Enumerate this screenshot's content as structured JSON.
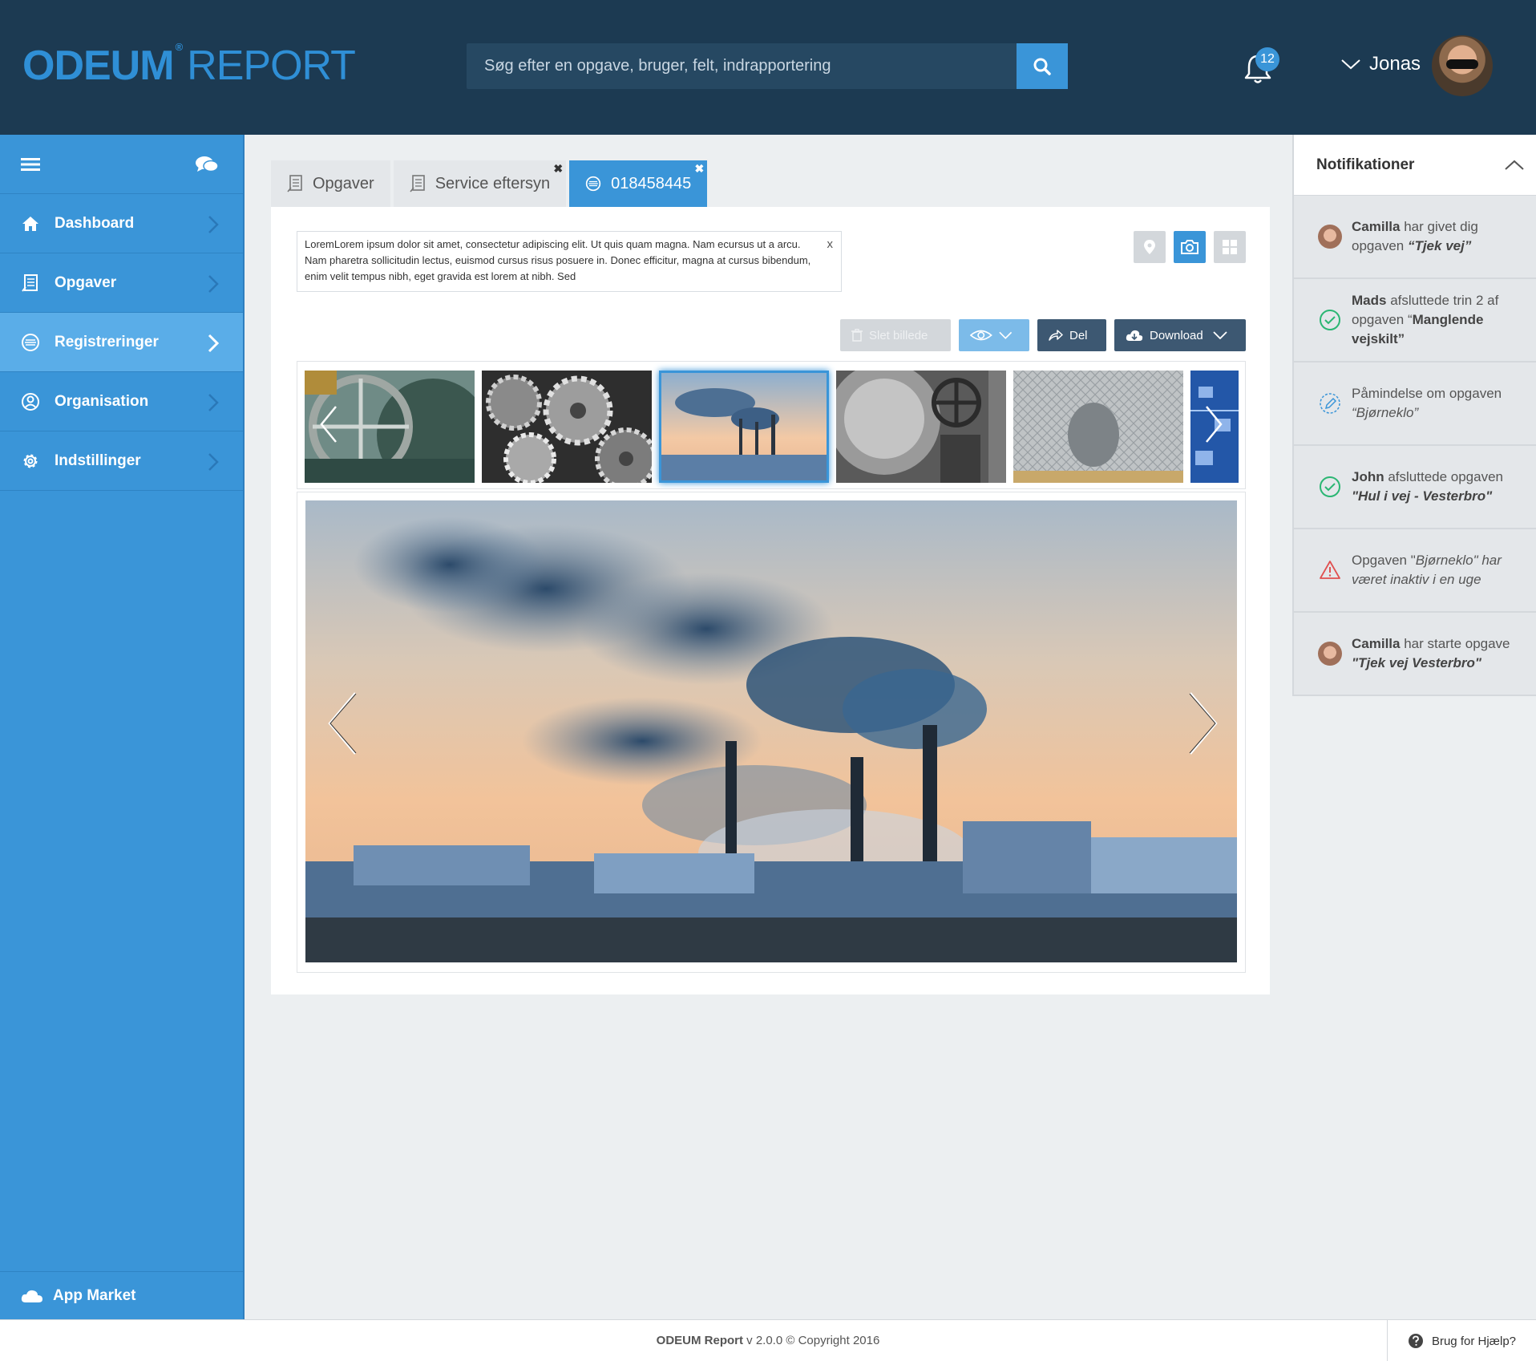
{
  "header": {
    "logo_part1": "ODEUM",
    "logo_reg": "®",
    "logo_part2": "REPORT",
    "search_placeholder": "Søg efter en opgave, bruger, felt, indrapportering",
    "notification_count": "12",
    "user_name": "Jonas"
  },
  "sidebar": {
    "items": [
      {
        "label": "Dashboard",
        "icon": "home-icon"
      },
      {
        "label": "Opgaver",
        "icon": "tasks-icon"
      },
      {
        "label": "Registreringer",
        "icon": "registrations-icon",
        "active": true
      },
      {
        "label": "Organisation",
        "icon": "user-icon"
      },
      {
        "label": "Indstillinger",
        "icon": "gear-icon"
      }
    ],
    "app_market": "App Market"
  },
  "tabs": [
    {
      "label": "Opgaver",
      "closable": false
    },
    {
      "label": "Service eftersyn",
      "closable": true
    },
    {
      "label": "018458445",
      "closable": true,
      "active": true
    }
  ],
  "info_text": "LoremLorem ipsum dolor sit amet, consectetur adipiscing elit. Ut quis quam magna. Nam ecursus ut a arcu. Nam pharetra sollicitudin lectus, euismod cursus risus posuere in. Donec efficitur, magna at cursus bibendum, enim velit tempus nibh, eget gravida est lorem at nibh. Sed",
  "info_close": "x",
  "actions": {
    "delete": "Slet billede",
    "share": "Del",
    "download": "Download"
  },
  "notifications": {
    "title": "Notifikationer",
    "items": [
      {
        "bold": "Camilla",
        "pre": "",
        "text": " har givet dig opgaven ",
        "em": "“Tjek vej”",
        "icon": "avatar"
      },
      {
        "bold": "Mads",
        "pre": "",
        "text": " afsluttede trin 2 af opgaven “",
        "em": "Manglende vejskilt”",
        "icon": "check-icon"
      },
      {
        "bold": "",
        "pre": "Påmindelse om opgaven ",
        "text": "",
        "em": "“Bjørneklo”",
        "icon": "pencil-icon"
      },
      {
        "bold": "John",
        "pre": "",
        "text": " afsluttede opgaven ",
        "em": "\"Hul i vej - Vesterbro\"",
        "icon": "check-icon"
      },
      {
        "bold": "",
        "pre": "Opgaven \"",
        "text": "",
        "em": "Bjørneklo\" har været inaktiv i en uge",
        "icon": "warning-icon"
      },
      {
        "bold": "Camilla",
        "pre": "",
        "text": " har starte opgave ",
        "em": "\"Tjek vej Vesterbro\"",
        "icon": "avatar"
      }
    ]
  },
  "footer": {
    "brand": "ODEUM Report",
    "version": " v 2.0.0 © Copyright 2016",
    "help": "Brug for Hjælp?"
  },
  "colors": {
    "header": "#1c3a52",
    "accent": "#3a95d8",
    "sidebar_active": "#5aade8"
  }
}
